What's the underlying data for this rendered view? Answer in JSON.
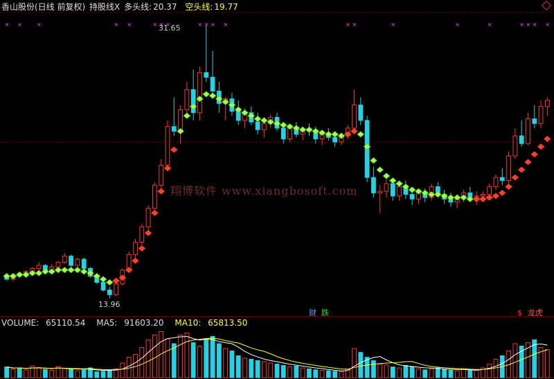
{
  "header": {
    "stock_title": "香山股份(日线 前复权)",
    "indicator": "持股线X",
    "long_label": "多头线:",
    "long_value": "20.37",
    "short_label": "空头线:",
    "short_value": "19.77"
  },
  "volume_header": {
    "label": "VOLUME:",
    "value": "65110.54",
    "ma5_label": "MA5:",
    "ma5_value": "91603.20",
    "ma10_label": "MA10:",
    "ma10_value": "65813.50"
  },
  "watermark": "翔博软件 www.xiangbosoft.com",
  "annotations": {
    "high": "31.65",
    "low": "13.96"
  },
  "event_tags": [
    {
      "text": "财",
      "color": "#4fa3ff"
    },
    {
      "text": "跌",
      "color": "#22dd22"
    },
    {
      "text": "$",
      "color": "#ff3333"
    },
    {
      "text": "龙虎",
      "color": "#ff5555"
    }
  ],
  "colors": {
    "up": "#ff3333",
    "down": "#22d3e6",
    "long_line": "#ff3333",
    "short_line": "#33ee33",
    "ma5": "#ffffff",
    "ma10": "#ffff33",
    "grid": "#8b0000",
    "marker": "#ff44ff"
  },
  "chart_data": {
    "type": "candlestick",
    "price_ylim": [
      13.0,
      32.5
    ],
    "candles": [
      [
        15.3,
        15.5,
        15.1,
        15.2
      ],
      [
        15.2,
        15.6,
        15.1,
        15.5
      ],
      [
        15.5,
        15.7,
        15.3,
        15.4
      ],
      [
        15.4,
        15.8,
        15.3,
        15.7
      ],
      [
        15.7,
        16.0,
        15.6,
        15.9
      ],
      [
        15.9,
        16.3,
        15.8,
        16.1
      ],
      [
        16.1,
        16.2,
        15.6,
        15.7
      ],
      [
        15.7,
        16.2,
        15.6,
        16.0
      ],
      [
        16.0,
        16.4,
        15.9,
        16.3
      ],
      [
        16.3,
        16.9,
        16.2,
        16.7
      ],
      [
        16.7,
        16.8,
        16.0,
        16.1
      ],
      [
        16.1,
        16.6,
        16.0,
        16.5
      ],
      [
        16.5,
        16.6,
        15.8,
        15.9
      ],
      [
        15.9,
        16.0,
        15.3,
        15.4
      ],
      [
        15.4,
        15.5,
        14.9,
        15.0
      ],
      [
        15.0,
        15.2,
        14.4,
        14.5
      ],
      [
        14.5,
        14.7,
        13.96,
        14.2
      ],
      [
        14.2,
        15.0,
        14.1,
        14.9
      ],
      [
        14.9,
        15.9,
        14.8,
        15.8
      ],
      [
        15.8,
        17.0,
        15.7,
        16.8
      ],
      [
        16.8,
        17.8,
        16.6,
        17.6
      ],
      [
        17.6,
        18.8,
        17.4,
        18.6
      ],
      [
        18.6,
        20.0,
        18.4,
        19.8
      ],
      [
        19.8,
        21.5,
        19.6,
        21.3
      ],
      [
        21.3,
        23.0,
        21.0,
        22.6
      ],
      [
        22.6,
        25.5,
        22.4,
        25.1
      ],
      [
        25.1,
        27.0,
        24.5,
        24.8
      ],
      [
        24.8,
        26.5,
        24.0,
        26.2
      ],
      [
        26.2,
        28.0,
        25.8,
        27.5
      ],
      [
        27.5,
        28.8,
        25.5,
        26.0
      ],
      [
        26.0,
        29.0,
        25.5,
        28.6
      ],
      [
        28.6,
        31.65,
        28.0,
        28.3
      ],
      [
        28.3,
        30.0,
        27.0,
        27.4
      ],
      [
        27.4,
        28.0,
        26.0,
        26.6
      ],
      [
        26.6,
        27.0,
        25.5,
        26.9
      ],
      [
        26.9,
        27.3,
        25.8,
        26.1
      ],
      [
        26.1,
        26.8,
        25.2,
        25.5
      ],
      [
        25.5,
        26.3,
        25.0,
        26.0
      ],
      [
        26.0,
        26.4,
        25.2,
        25.4
      ],
      [
        25.4,
        26.0,
        24.6,
        24.9
      ],
      [
        24.9,
        25.6,
        24.4,
        25.3
      ],
      [
        25.3,
        25.9,
        25.0,
        25.7
      ],
      [
        25.7,
        26.0,
        24.8,
        25.0
      ],
      [
        25.0,
        25.4,
        24.0,
        24.3
      ],
      [
        24.3,
        25.2,
        24.1,
        25.0
      ],
      [
        25.0,
        25.4,
        24.4,
        24.6
      ],
      [
        24.6,
        25.1,
        24.2,
        24.9
      ],
      [
        24.9,
        25.3,
        24.5,
        24.8
      ],
      [
        24.8,
        25.1,
        24.0,
        24.3
      ],
      [
        24.3,
        24.8,
        23.9,
        24.6
      ],
      [
        24.6,
        25.0,
        24.2,
        24.4
      ],
      [
        24.4,
        24.8,
        23.8,
        24.1
      ],
      [
        24.1,
        24.7,
        23.9,
        24.5
      ],
      [
        24.5,
        25.2,
        24.3,
        25.0
      ],
      [
        25.0,
        27.5,
        24.8,
        26.5
      ],
      [
        26.5,
        27.0,
        25.2,
        25.5
      ],
      [
        25.5,
        25.8,
        21.5,
        21.8
      ],
      [
        21.8,
        22.5,
        20.5,
        20.8
      ],
      [
        20.8,
        21.3,
        19.5,
        20.9
      ],
      [
        20.9,
        21.8,
        20.5,
        21.4
      ],
      [
        21.4,
        21.7,
        20.3,
        20.6
      ],
      [
        20.6,
        21.5,
        20.3,
        21.2
      ],
      [
        21.2,
        21.6,
        20.4,
        20.7
      ],
      [
        20.7,
        21.2,
        20.0,
        20.4
      ],
      [
        20.4,
        21.0,
        20.1,
        20.8
      ],
      [
        20.8,
        21.1,
        20.2,
        20.5
      ],
      [
        20.5,
        21.4,
        20.3,
        21.2
      ],
      [
        21.2,
        21.5,
        20.5,
        20.7
      ],
      [
        20.7,
        21.0,
        20.1,
        20.4
      ],
      [
        20.4,
        20.8,
        19.9,
        20.2
      ],
      [
        20.2,
        20.7,
        19.8,
        20.5
      ],
      [
        20.5,
        21.0,
        20.2,
        20.8
      ],
      [
        20.8,
        21.2,
        20.3,
        20.4
      ],
      [
        20.4,
        20.9,
        20.0,
        20.6
      ],
      [
        20.6,
        20.9,
        20.2,
        20.7
      ],
      [
        20.7,
        21.4,
        20.5,
        21.2
      ],
      [
        21.2,
        22.0,
        21.0,
        21.8
      ],
      [
        21.8,
        22.4,
        21.3,
        21.6
      ],
      [
        21.6,
        23.5,
        21.4,
        23.2
      ],
      [
        23.2,
        25.0,
        23.0,
        24.5
      ],
      [
        24.5,
        25.5,
        23.8,
        24.0
      ],
      [
        24.0,
        26.0,
        23.9,
        25.6
      ],
      [
        25.6,
        26.5,
        25.0,
        25.3
      ],
      [
        25.3,
        26.8,
        25.0,
        26.4
      ],
      [
        26.4,
        27.0,
        25.8,
        26.8
      ]
    ],
    "long_line": [
      15.4,
      15.4,
      15.5,
      15.5,
      15.6,
      15.6,
      15.7,
      15.7,
      15.8,
      15.8,
      15.8,
      15.8,
      15.7,
      15.6,
      15.4,
      15.2,
      15.0,
      15.1,
      15.3,
      15.8,
      16.4,
      17.2,
      18.2,
      19.5,
      20.9,
      22.4,
      23.6,
      24.8,
      25.8,
      26.4,
      26.9,
      27.2,
      27.1,
      26.9,
      26.7,
      26.5,
      26.2,
      26.0,
      25.8,
      25.6,
      25.5,
      25.4,
      25.3,
      25.2,
      25.1,
      25.0,
      24.9,
      24.9,
      24.8,
      24.7,
      24.6,
      24.6,
      24.5,
      24.6,
      24.8,
      24.6,
      23.8,
      22.9,
      22.3,
      21.9,
      21.6,
      21.4,
      21.2,
      21.0,
      20.9,
      20.8,
      20.7,
      20.7,
      20.6,
      20.5,
      20.5,
      20.5,
      20.4,
      20.4,
      20.4,
      20.5,
      20.6,
      20.8,
      21.2,
      21.8,
      22.3,
      22.8,
      23.3,
      23.8,
      24.3
    ],
    "short_signal": [
      1,
      1,
      1,
      1,
      1,
      1,
      1,
      1,
      1,
      1,
      1,
      1,
      1,
      1,
      1,
      1,
      1,
      0,
      0,
      0,
      0,
      0,
      0,
      0,
      0,
      0,
      0,
      1,
      1,
      1,
      1,
      1,
      1,
      1,
      1,
      1,
      1,
      1,
      1,
      1,
      1,
      1,
      1,
      1,
      1,
      1,
      1,
      1,
      1,
      1,
      1,
      1,
      1,
      0,
      0,
      1,
      1,
      1,
      1,
      1,
      1,
      1,
      1,
      1,
      1,
      1,
      1,
      1,
      1,
      1,
      1,
      1,
      1,
      0,
      0,
      0,
      0,
      0,
      0,
      0,
      0,
      0,
      0,
      0,
      0
    ],
    "volume": [
      22,
      18,
      20,
      16,
      24,
      21,
      17,
      15,
      23,
      19,
      17,
      14,
      16,
      20,
      12,
      13,
      15,
      18,
      30,
      42,
      48,
      62,
      78,
      88,
      95,
      80,
      70,
      88,
      92,
      72,
      65,
      80,
      85,
      70,
      60,
      55,
      45,
      40,
      38,
      35,
      33,
      30,
      28,
      25,
      22,
      24,
      20,
      18,
      16,
      15,
      14,
      13,
      12,
      18,
      60,
      52,
      42,
      35,
      28,
      26,
      22,
      20,
      25,
      22,
      18,
      16,
      18,
      20,
      17,
      15,
      14,
      18,
      16,
      15,
      20,
      28,
      38,
      45,
      55,
      70,
      65,
      72,
      78,
      62,
      58
    ],
    "volume_ylim": [
      0,
      100
    ]
  }
}
